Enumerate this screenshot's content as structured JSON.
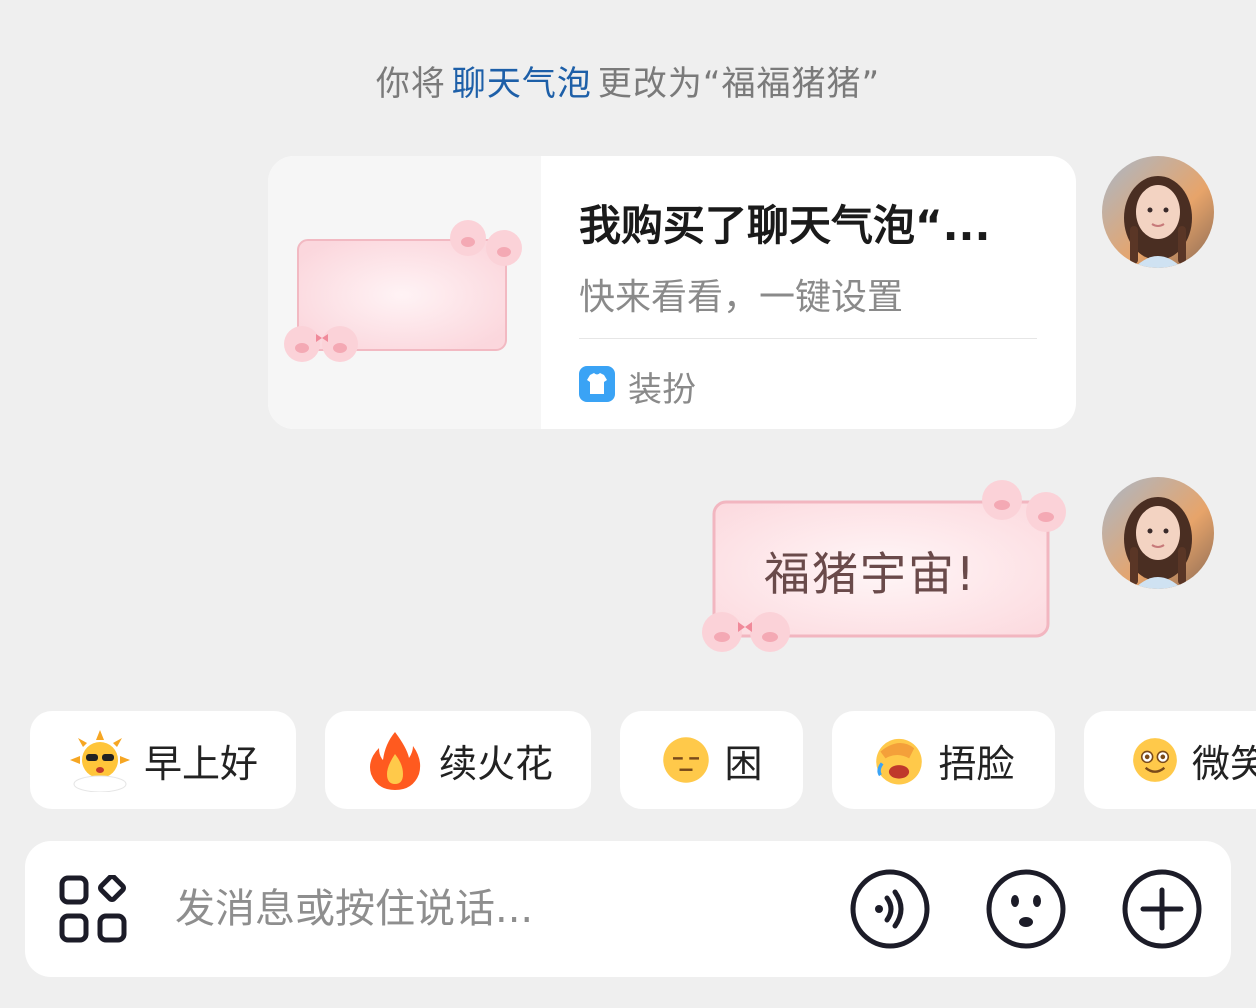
{
  "system_notice": {
    "prefix": "你将",
    "link": "聊天气泡",
    "suffix": "更改为“福福猪猪”"
  },
  "share_card": {
    "title": "我购买了聊天气泡“...",
    "subtitle": "快来看看，一键设置",
    "source_icon": "shirt-icon",
    "source_label": "装扮"
  },
  "message": {
    "text": "福猪宇宙!"
  },
  "quick_replies": [
    {
      "icon": "sun-sunglasses-emoji",
      "label": "早上好"
    },
    {
      "icon": "fire-emoji",
      "label": "续火花"
    },
    {
      "icon": "sleepy-face-emoji",
      "label": "困"
    },
    {
      "icon": "facepalm-laugh-emoji",
      "label": "捂脸"
    },
    {
      "icon": "smile-face-emoji",
      "label": "微笑"
    }
  ],
  "input_bar": {
    "placeholder": "发消息或按住说话...",
    "apps_icon": "apps-grid-icon",
    "voice_icon": "voice-wave-icon",
    "emoji_icon": "emoji-face-icon",
    "plus_icon": "plus-icon"
  },
  "colors": {
    "background": "#efefef",
    "link": "#1d5fa8",
    "bubble_pink": "#fde2e6",
    "card_bg": "#ffffff"
  }
}
